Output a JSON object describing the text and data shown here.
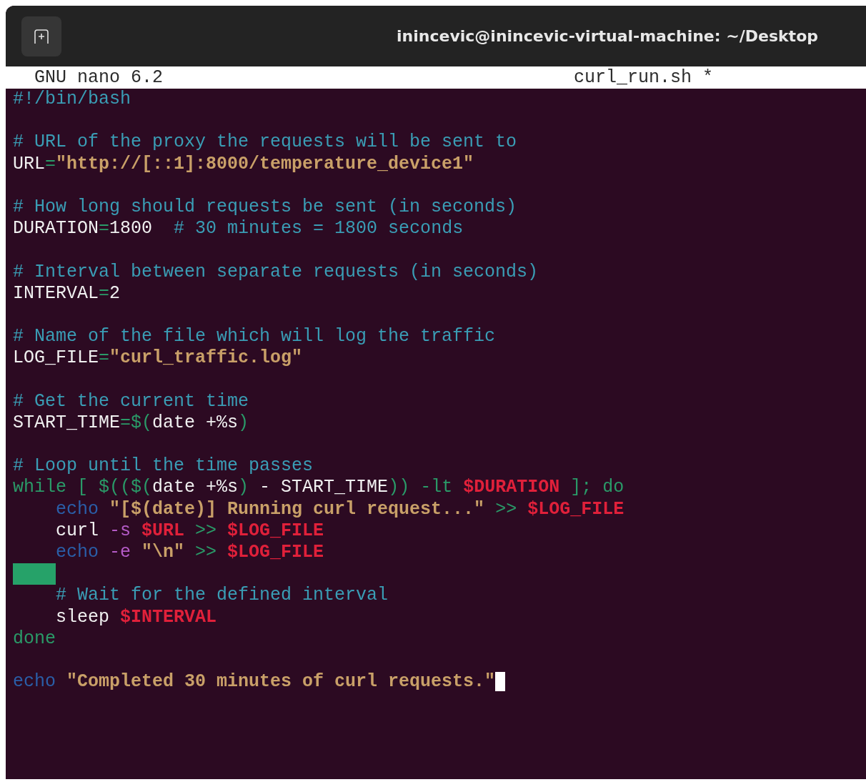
{
  "window": {
    "title": "inincevic@inincevic-virtual-machine: ~/Desktop"
  },
  "nano_header": {
    "version": "GNU nano 6.2",
    "file_name": "curl_run.sh *"
  },
  "lines": [
    {
      "kind": "code",
      "cursor": false,
      "segments": [
        {
          "text": "#!/bin/bash",
          "kind": "comment"
        }
      ]
    },
    {
      "kind": "blank"
    },
    {
      "kind": "code",
      "cursor": false,
      "segments": [
        {
          "text": "# URL of the proxy the requests will be sent to",
          "kind": "comment"
        }
      ]
    },
    {
      "kind": "code",
      "cursor": false,
      "segments": [
        {
          "text": "URL",
          "kind": "plain"
        },
        {
          "text": "=",
          "kind": "keyword"
        },
        {
          "text": "\"http://[::1]:8000/temperature_device1\"",
          "kind": "string"
        }
      ]
    },
    {
      "kind": "blank"
    },
    {
      "kind": "code",
      "cursor": false,
      "segments": [
        {
          "text": "# How long should requests be sent (in seconds)",
          "kind": "comment"
        }
      ]
    },
    {
      "kind": "code",
      "cursor": false,
      "segments": [
        {
          "text": "DURATION",
          "kind": "plain"
        },
        {
          "text": "=",
          "kind": "keyword"
        },
        {
          "text": "1800",
          "kind": "plain"
        },
        {
          "text": "  # 30 minutes = 1800 seconds",
          "kind": "comment"
        }
      ]
    },
    {
      "kind": "blank"
    },
    {
      "kind": "code",
      "cursor": false,
      "segments": [
        {
          "text": "# Interval between separate requests (in seconds)",
          "kind": "comment"
        }
      ]
    },
    {
      "kind": "code",
      "cursor": false,
      "segments": [
        {
          "text": "INTERVAL",
          "kind": "plain"
        },
        {
          "text": "=",
          "kind": "keyword"
        },
        {
          "text": "2",
          "kind": "plain"
        }
      ]
    },
    {
      "kind": "blank"
    },
    {
      "kind": "code",
      "cursor": false,
      "segments": [
        {
          "text": "# Name of the file which will log the traffic",
          "kind": "comment"
        }
      ]
    },
    {
      "kind": "code",
      "cursor": false,
      "segments": [
        {
          "text": "LOG_FILE",
          "kind": "plain"
        },
        {
          "text": "=",
          "kind": "keyword"
        },
        {
          "text": "\"curl_traffic.log\"",
          "kind": "string"
        }
      ]
    },
    {
      "kind": "blank"
    },
    {
      "kind": "code",
      "cursor": false,
      "segments": [
        {
          "text": "# Get the current time",
          "kind": "comment"
        }
      ]
    },
    {
      "kind": "code",
      "cursor": false,
      "segments": [
        {
          "text": "START_TIME",
          "kind": "plain"
        },
        {
          "text": "=$(",
          "kind": "keyword"
        },
        {
          "text": "date +%s",
          "kind": "plain"
        },
        {
          "text": ")",
          "kind": "keyword"
        }
      ]
    },
    {
      "kind": "blank"
    },
    {
      "kind": "code",
      "cursor": false,
      "segments": [
        {
          "text": "# Loop until the time passes",
          "kind": "comment"
        }
      ]
    },
    {
      "kind": "code",
      "cursor": false,
      "segments": [
        {
          "text": "while [ $(($(",
          "kind": "keyword"
        },
        {
          "text": "date +%s",
          "kind": "plain"
        },
        {
          "text": ")",
          "kind": "keyword"
        },
        {
          "text": " - START_TIME",
          "kind": "plain"
        },
        {
          "text": ")) -lt ",
          "kind": "keyword"
        },
        {
          "text": "$DURATION",
          "kind": "variable"
        },
        {
          "text": " ]; do",
          "kind": "keyword"
        }
      ]
    },
    {
      "kind": "code",
      "cursor": false,
      "segments": [
        {
          "text": "    echo",
          "kind": "builtin"
        },
        {
          "text": " \"[$(date)] Running curl request...\"",
          "kind": "string"
        },
        {
          "text": " >> ",
          "kind": "keyword"
        },
        {
          "text": "$LOG_FILE",
          "kind": "variable"
        }
      ]
    },
    {
      "kind": "code",
      "cursor": false,
      "segments": [
        {
          "text": "    curl ",
          "kind": "plain"
        },
        {
          "text": "-s",
          "kind": "option"
        },
        {
          "text": " $URL",
          "kind": "variable"
        },
        {
          "text": " >> ",
          "kind": "keyword"
        },
        {
          "text": "$LOG_FILE",
          "kind": "variable"
        }
      ]
    },
    {
      "kind": "code",
      "cursor": false,
      "segments": [
        {
          "text": "    echo",
          "kind": "builtin"
        },
        {
          "text": " -e",
          "kind": "option"
        },
        {
          "text": " \"\\n\"",
          "kind": "string"
        },
        {
          "text": " >> ",
          "kind": "keyword"
        },
        {
          "text": "$LOG_FILE",
          "kind": "variable"
        }
      ]
    },
    {
      "kind": "whitespace"
    },
    {
      "kind": "code",
      "cursor": false,
      "segments": [
        {
          "text": "    # Wait for the defined interval",
          "kind": "comment"
        }
      ]
    },
    {
      "kind": "code",
      "cursor": false,
      "segments": [
        {
          "text": "    sleep ",
          "kind": "plain"
        },
        {
          "text": "$INTERVAL",
          "kind": "variable"
        }
      ]
    },
    {
      "kind": "code",
      "cursor": false,
      "segments": [
        {
          "text": "done",
          "kind": "keyword"
        }
      ]
    },
    {
      "kind": "blank"
    },
    {
      "kind": "code",
      "cursor": true,
      "segments": [
        {
          "text": "echo",
          "kind": "builtin"
        },
        {
          "text": " \"Completed 30 minutes of curl requests.\"",
          "kind": "string"
        }
      ]
    }
  ]
}
